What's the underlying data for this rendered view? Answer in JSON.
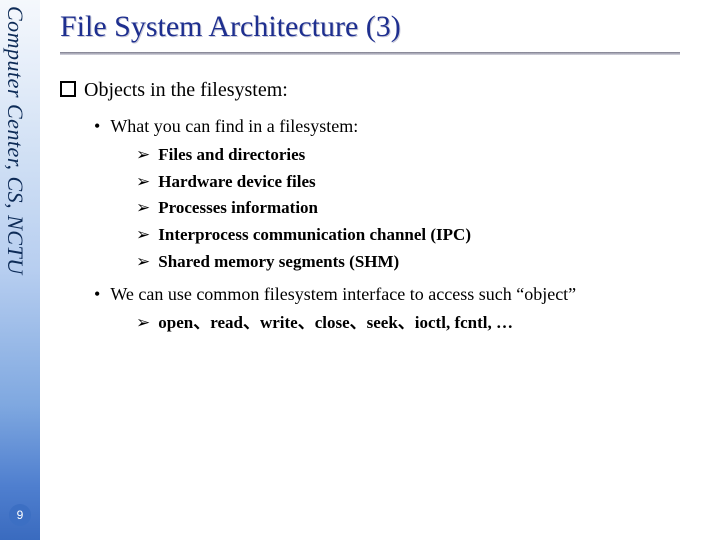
{
  "sidebar_text": "Computer Center, CS, NCTU",
  "page_number": "9",
  "title": "File System Architecture (3)",
  "lvl1_text": "Objects in the filesystem:",
  "lvl2a_text": "What you can find in a filesystem:",
  "lvl3a1": "Files and directories",
  "lvl3a2": "Hardware device files",
  "lvl3a3": "Processes information",
  "lvl3a4": "Interprocess communication channel (IPC)",
  "lvl3a5": "Shared memory segments (SHM)",
  "lvl2b_text": "We can use common filesystem interface to access such “object”",
  "lvl3b1": "open、read、write、close、seek、ioctl, fcntl, …"
}
